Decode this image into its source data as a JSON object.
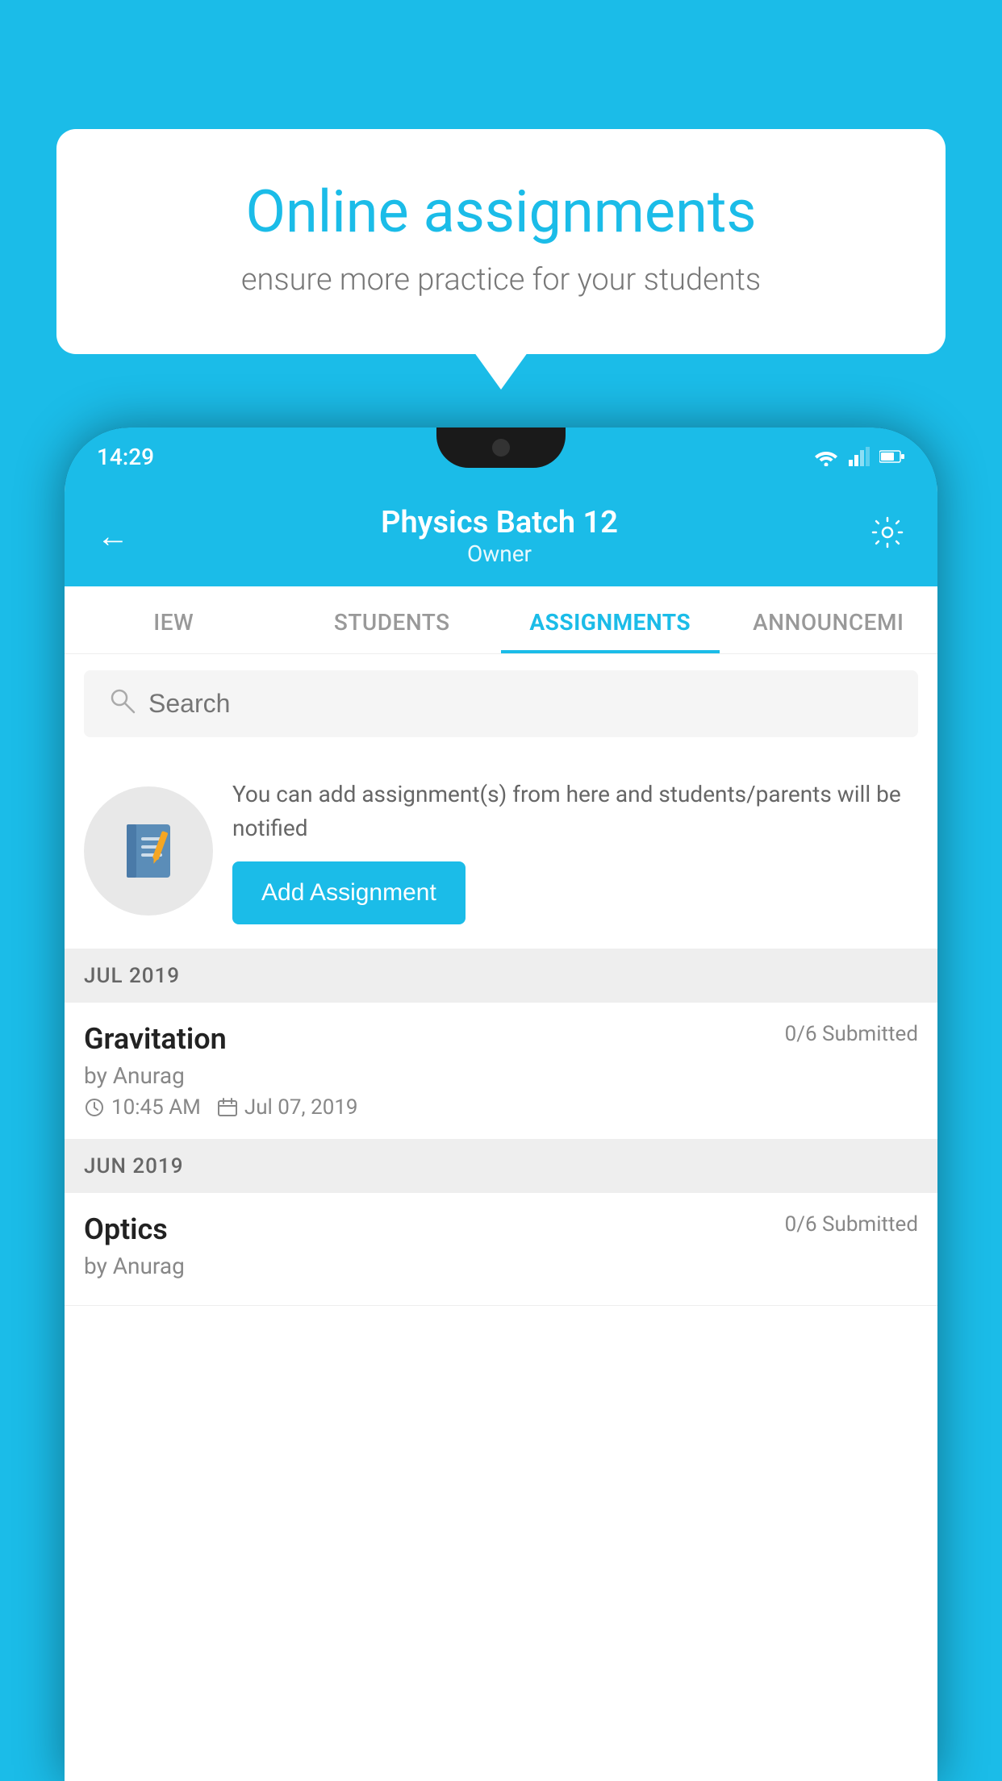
{
  "background_color": "#1BBCE8",
  "speech_bubble": {
    "title": "Online assignments",
    "subtitle": "ensure more practice for your students"
  },
  "phone": {
    "status_bar": {
      "time": "14:29"
    },
    "header": {
      "title": "Physics Batch 12",
      "subtitle": "Owner"
    },
    "tabs": [
      {
        "label": "IEW",
        "active": false
      },
      {
        "label": "STUDENTS",
        "active": false
      },
      {
        "label": "ASSIGNMENTS",
        "active": true
      },
      {
        "label": "ANNOUNCEMI",
        "active": false
      }
    ],
    "search": {
      "placeholder": "Search"
    },
    "empty_state": {
      "description": "You can add assignment(s) from here and students/parents will be notified",
      "button_label": "Add Assignment"
    },
    "assignments": {
      "sections": [
        {
          "month_label": "JUL 2019",
          "items": [
            {
              "title": "Gravitation",
              "submitted": "0/6 Submitted",
              "author": "by Anurag",
              "time": "10:45 AM",
              "date": "Jul 07, 2019"
            }
          ]
        },
        {
          "month_label": "JUN 2019",
          "items": [
            {
              "title": "Optics",
              "submitted": "0/6 Submitted",
              "author": "by Anurag",
              "time": "",
              "date": ""
            }
          ]
        }
      ]
    }
  }
}
